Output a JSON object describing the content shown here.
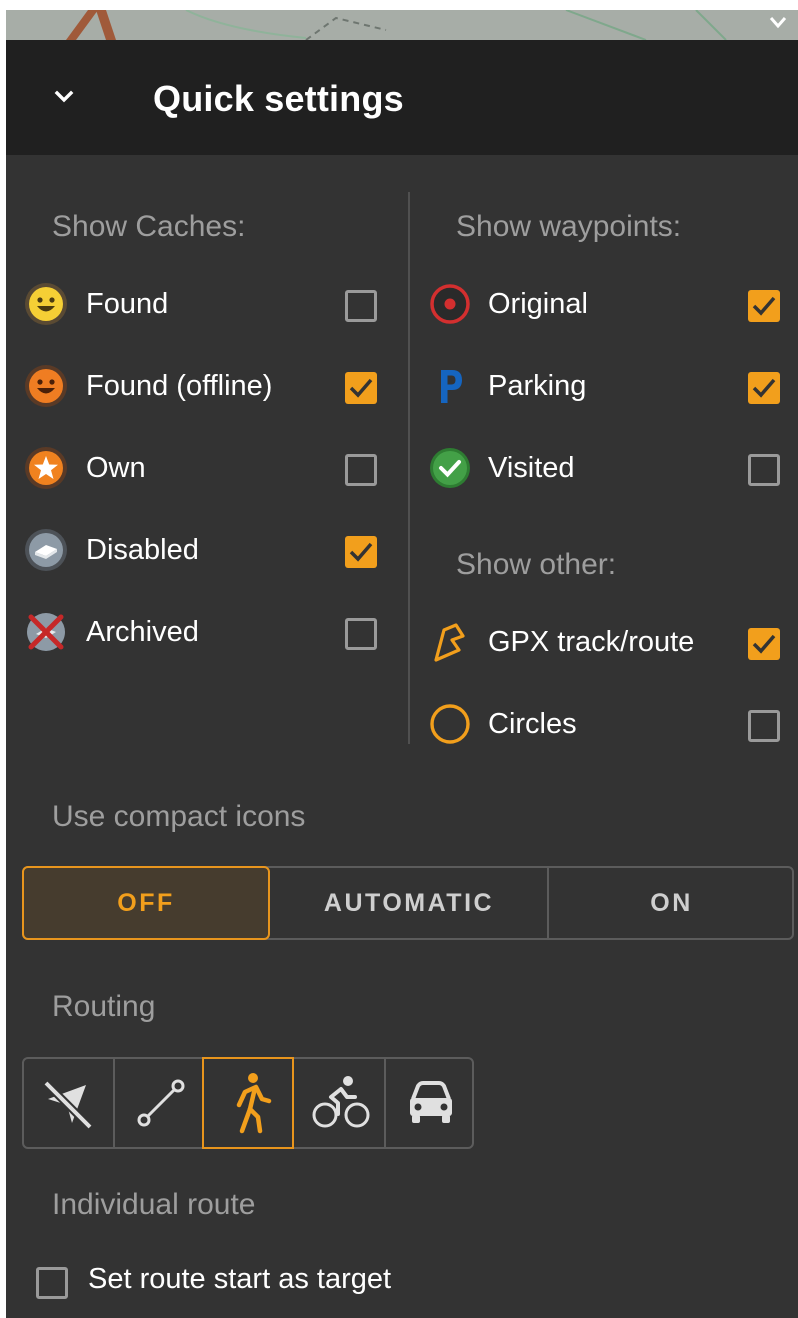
{
  "header": {
    "title": "Quick settings",
    "collapse_icon": "chevron-down-icon"
  },
  "caches": {
    "title": "Show Caches:",
    "items": [
      {
        "label": "Found",
        "icon": "smiley-yellow-icon",
        "checked": false
      },
      {
        "label": "Found (offline)",
        "icon": "smiley-orange-icon",
        "checked": true
      },
      {
        "label": "Own",
        "icon": "star-icon",
        "checked": false
      },
      {
        "label": "Disabled",
        "icon": "disabled-cache-icon",
        "checked": true
      },
      {
        "label": "Archived",
        "icon": "archived-cache-icon",
        "checked": false
      }
    ]
  },
  "waypoints": {
    "title": "Show waypoints:",
    "items": [
      {
        "label": "Original",
        "icon": "original-target-icon",
        "checked": true
      },
      {
        "label": "Parking",
        "icon": "parking-icon",
        "checked": true
      },
      {
        "label": "Visited",
        "icon": "visited-check-icon",
        "checked": false
      }
    ]
  },
  "other": {
    "title": "Show other:",
    "items": [
      {
        "label": "GPX track/route",
        "icon": "gpx-track-icon",
        "checked": true
      },
      {
        "label": "Circles",
        "icon": "circle-icon",
        "checked": false
      }
    ]
  },
  "compact_icons": {
    "title": "Use compact icons",
    "options": [
      "OFF",
      "AUTOMATIC",
      "ON"
    ],
    "selected": "OFF"
  },
  "routing": {
    "title": "Routing",
    "modes": [
      "routing-off-icon",
      "straight-line-icon",
      "walking-icon",
      "cycling-icon",
      "car-icon"
    ],
    "selected": "walking-icon"
  },
  "individual_route": {
    "title": "Individual route",
    "checkbox_label": "Set route start as target",
    "checked": false
  },
  "colors": {
    "accent": "#f29f1c",
    "panel": "#333333",
    "header": "#202020",
    "muted_text": "#9e9e9e"
  }
}
